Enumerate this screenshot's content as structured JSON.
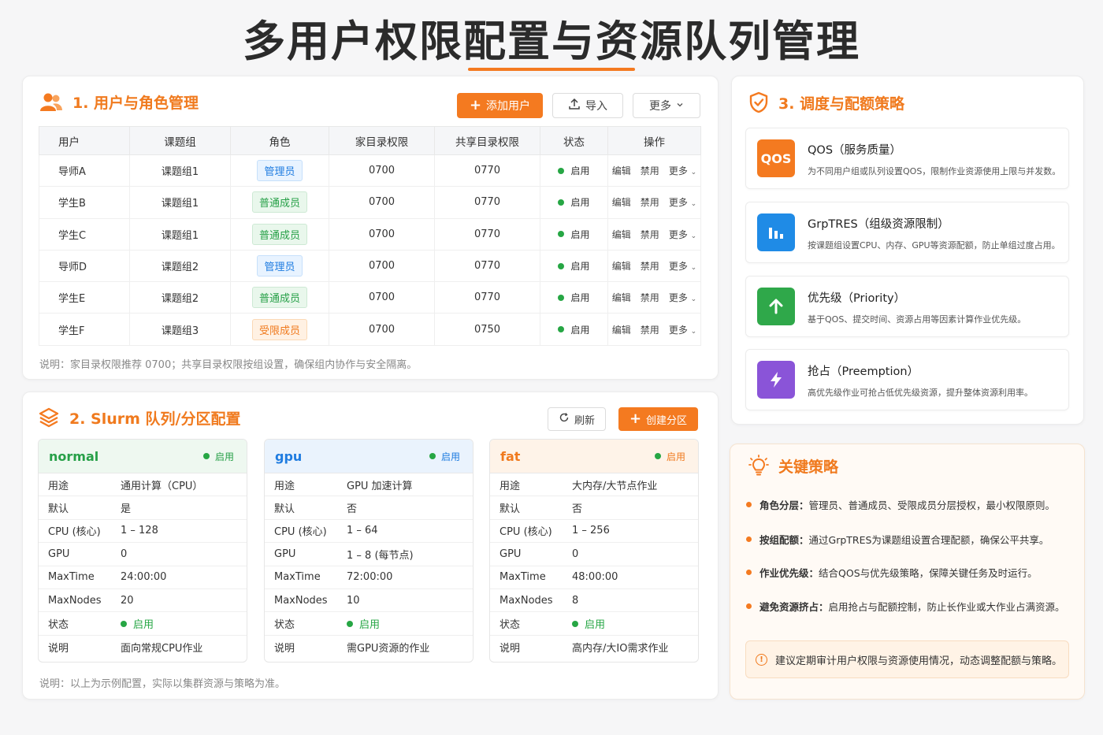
{
  "title": "多用户权限配置与资源队列管理",
  "users_section": {
    "title": "1. 用户与角色管理",
    "add_user": "添加用户",
    "import": "导入",
    "more": "更多",
    "columns": [
      "用户",
      "课题组",
      "角色",
      "家目录权限",
      "共享目录权限",
      "状态",
      "操作"
    ],
    "rows": [
      {
        "user": "导师A",
        "group": "课题组1",
        "role": "管理员",
        "role_type": "admin",
        "home": "0700",
        "shared": "0770",
        "status": "启用"
      },
      {
        "user": "学生B",
        "group": "课题组1",
        "role": "普通成员",
        "role_type": "normal",
        "home": "0700",
        "shared": "0770",
        "status": "启用"
      },
      {
        "user": "学生C",
        "group": "课题组1",
        "role": "普通成员",
        "role_type": "normal",
        "home": "0700",
        "shared": "0770",
        "status": "启用"
      },
      {
        "user": "导师D",
        "group": "课题组2",
        "role": "管理员",
        "role_type": "admin",
        "home": "0700",
        "shared": "0770",
        "status": "启用"
      },
      {
        "user": "学生E",
        "group": "课题组2",
        "role": "普通成员",
        "role_type": "normal",
        "home": "0700",
        "shared": "0770",
        "status": "启用"
      },
      {
        "user": "学生F",
        "group": "课题组3",
        "role": "受限成员",
        "role_type": "limited",
        "home": "0700",
        "shared": "0750",
        "status": "启用"
      }
    ],
    "ops": {
      "edit": "编辑",
      "disable": "禁用",
      "more": "更多"
    },
    "note": "说明：家目录权限推荐 0700；共享目录权限按组设置，确保组内协作与安全隔离。"
  },
  "slurm_section": {
    "title": "2. Slurm 队列/分区配置",
    "refresh": "刷新",
    "create": "创建分区",
    "partitions": [
      {
        "name": "normal",
        "status": "启用",
        "color": "#27a048",
        "head_bg": "#eef8f0",
        "rows": [
          {
            "k": "用途",
            "v": "通用计算（CPU）"
          },
          {
            "k": "默认",
            "v": "是"
          },
          {
            "k": "CPU (核心)",
            "v": "1 – 128"
          },
          {
            "k": "GPU",
            "v": "0"
          },
          {
            "k": "MaxTime",
            "v": "24:00:00"
          },
          {
            "k": "MaxNodes",
            "v": "20"
          },
          {
            "k": "状态",
            "v": "启用"
          },
          {
            "k": "说明",
            "v": "面向常规CPU作业"
          }
        ]
      },
      {
        "name": "gpu",
        "status": "启用",
        "color": "#1f7ce0",
        "head_bg": "#eaf3fd",
        "rows": [
          {
            "k": "用途",
            "v": "GPU 加速计算"
          },
          {
            "k": "默认",
            "v": "否"
          },
          {
            "k": "CPU (核心)",
            "v": "1 – 64"
          },
          {
            "k": "GPU",
            "v": "1 – 8 (每节点)"
          },
          {
            "k": "MaxTime",
            "v": "72:00:00"
          },
          {
            "k": "MaxNodes",
            "v": "10"
          },
          {
            "k": "状态",
            "v": "启用"
          },
          {
            "k": "说明",
            "v": "需GPU资源的作业"
          }
        ]
      },
      {
        "name": "fat",
        "status": "启用",
        "color": "#f07a1e",
        "head_bg": "#fef3e8",
        "rows": [
          {
            "k": "用途",
            "v": "大内存/大节点作业"
          },
          {
            "k": "默认",
            "v": "否"
          },
          {
            "k": "CPU (核心)",
            "v": "1 – 256"
          },
          {
            "k": "GPU",
            "v": "0"
          },
          {
            "k": "MaxTime",
            "v": "48:00:00"
          },
          {
            "k": "MaxNodes",
            "v": "8"
          },
          {
            "k": "状态",
            "v": "启用"
          },
          {
            "k": "说明",
            "v": "高内存/大IO需求作业"
          }
        ]
      }
    ],
    "note": "说明：以上为示例配置，实际以集群资源与策略为准。"
  },
  "strategy_section": {
    "title": "3. 调度与配额策略",
    "items": [
      {
        "icon": "qos-icon",
        "icon_text": "QOS",
        "color": "#f47a20",
        "title": "QOS（服务质量）",
        "desc": "为不同用户组或队列设置QOS，限制作业资源使用上限与并发数。"
      },
      {
        "icon": "bar-chart-icon",
        "color": "#1f8be6",
        "title": "GrpTRES（组级资源限制）",
        "desc": "按课题组设置CPU、内存、GPU等资源配额，防止单组过度占用。"
      },
      {
        "icon": "arrow-up-icon",
        "color": "#2fa84a",
        "title": "优先级（Priority）",
        "desc": "基于QOS、提交时间、资源占用等因素计算作业优先级。"
      },
      {
        "icon": "lightning-icon",
        "color": "#8a54d8",
        "title": "抢占（Preemption）",
        "desc": "高优先级作业可抢占低优先级资源，提升整体资源利用率。"
      }
    ]
  },
  "key_section": {
    "title": "关键策略",
    "items": [
      {
        "label": "角色分层：",
        "text": "管理员、普通成员、受限成员分层授权，最小权限原则。"
      },
      {
        "label": "按组配额：",
        "text": "通过GrpTRES为课题组设置合理配额，确保公平共享。"
      },
      {
        "label": "作业优先级：",
        "text": "结合QOS与优先级策略，保障关键任务及时运行。"
      },
      {
        "label": "避免资源挤占：",
        "text": "启用抢占与配额控制，防止长作业或大作业占满资源。"
      }
    ],
    "tip": "建议定期审计用户权限与资源使用情况，动态调整配额与策略。"
  }
}
